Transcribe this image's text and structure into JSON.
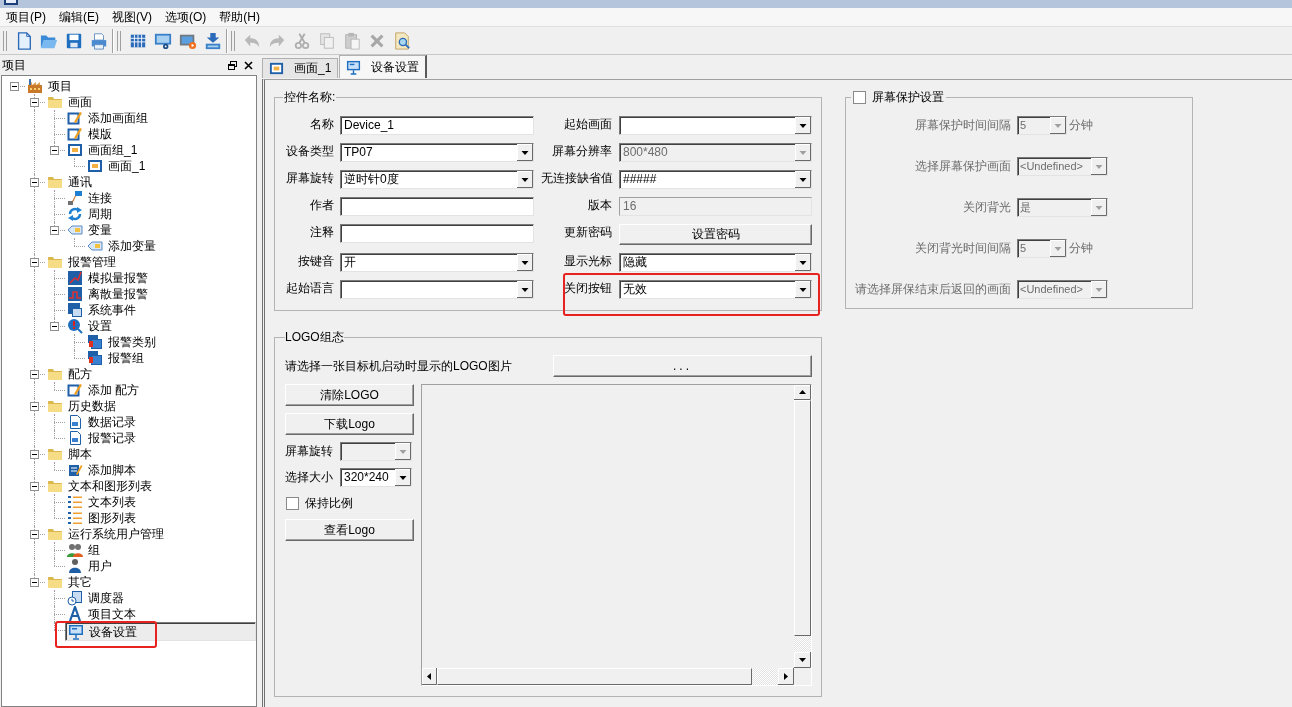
{
  "menu": [
    "项目(P)",
    "编辑(E)",
    "视图(V)",
    "选项(O)",
    "帮助(H)"
  ],
  "toolbar": [
    [
      {
        "kind": "new",
        "disabled": false
      },
      {
        "kind": "open",
        "disabled": false
      },
      {
        "kind": "save",
        "disabled": false
      },
      {
        "kind": "print",
        "disabled": false
      }
    ],
    [
      {
        "kind": "grid",
        "disabled": false
      },
      {
        "kind": "screen-gear",
        "disabled": false
      },
      {
        "kind": "screen-play",
        "disabled": false
      },
      {
        "kind": "download",
        "disabled": false
      }
    ],
    [
      {
        "kind": "undo",
        "disabled": true
      },
      {
        "kind": "redo",
        "disabled": true
      },
      {
        "kind": "cut",
        "disabled": true
      },
      {
        "kind": "copy",
        "disabled": true
      },
      {
        "kind": "paste",
        "disabled": true
      },
      {
        "kind": "delete",
        "disabled": true
      },
      {
        "kind": "preview",
        "disabled": false
      }
    ]
  ],
  "project_panel": {
    "title": "项目",
    "tree": [
      {
        "label": "项目",
        "kind": "factory",
        "expanded": true,
        "selected": false,
        "highlighted": false,
        "children": [
          {
            "label": "画面",
            "kind": "folder",
            "expanded": true,
            "selected": false,
            "highlighted": false,
            "children": [
              {
                "label": "添加画面组",
                "kind": "edit",
                "selected": false,
                "highlighted": false
              },
              {
                "label": "模版",
                "kind": "edit",
                "selected": false,
                "highlighted": false
              },
              {
                "label": "画面组_1",
                "kind": "screen",
                "expanded": true,
                "selected": false,
                "highlighted": false,
                "children": [
                  {
                    "label": "画面_1",
                    "kind": "screen",
                    "selected": false,
                    "highlighted": false
                  }
                ]
              }
            ]
          },
          {
            "label": "通讯",
            "kind": "folder",
            "expanded": true,
            "selected": false,
            "highlighted": false,
            "children": [
              {
                "label": "连接",
                "kind": "link",
                "selected": false,
                "highlighted": false
              },
              {
                "label": "周期",
                "kind": "cycle",
                "selected": false,
                "highlighted": false
              },
              {
                "label": "变量",
                "kind": "tag",
                "expanded": true,
                "selected": false,
                "highlighted": false,
                "children": [
                  {
                    "label": "添加变量",
                    "kind": "tag",
                    "selected": false,
                    "highlighted": false
                  }
                ]
              }
            ]
          },
          {
            "label": "报警管理",
            "kind": "folder",
            "expanded": true,
            "selected": false,
            "highlighted": false,
            "children": [
              {
                "label": "模拟量报警",
                "kind": "chart",
                "selected": false,
                "highlighted": false
              },
              {
                "label": "离散量报警",
                "kind": "pulse",
                "selected": false,
                "highlighted": false
              },
              {
                "label": "系统事件",
                "kind": "window",
                "selected": false,
                "highlighted": false
              },
              {
                "label": "设置",
                "kind": "alert",
                "expanded": true,
                "selected": false,
                "highlighted": false,
                "children": [
                  {
                    "label": "报警类别",
                    "kind": "stack",
                    "selected": false,
                    "highlighted": false
                  },
                  {
                    "label": "报警组",
                    "kind": "stack",
                    "selected": false,
                    "highlighted": false
                  }
                ]
              }
            ]
          },
          {
            "label": "配方",
            "kind": "folder",
            "expanded": true,
            "selected": false,
            "highlighted": false,
            "children": [
              {
                "label": "添加 配方",
                "kind": "edit",
                "selected": false,
                "highlighted": false
              }
            ]
          },
          {
            "label": "历史数据",
            "kind": "folder",
            "expanded": true,
            "selected": false,
            "highlighted": false,
            "children": [
              {
                "label": "数据记录",
                "kind": "doc",
                "selected": false,
                "highlighted": false
              },
              {
                "label": "报警记录",
                "kind": "doc",
                "selected": false,
                "highlighted": false
              }
            ]
          },
          {
            "label": "脚本",
            "kind": "folder",
            "expanded": true,
            "selected": false,
            "highlighted": false,
            "children": [
              {
                "label": "添加脚本",
                "kind": "script",
                "selected": false,
                "highlighted": false
              }
            ]
          },
          {
            "label": "文本和图形列表",
            "kind": "folder",
            "expanded": true,
            "selected": false,
            "highlighted": false,
            "children": [
              {
                "label": "文本列表",
                "kind": "list",
                "selected": false,
                "highlighted": false
              },
              {
                "label": "图形列表",
                "kind": "list",
                "selected": false,
                "highlighted": false
              }
            ]
          },
          {
            "label": "运行系统用户管理",
            "kind": "folder",
            "expanded": true,
            "selected": false,
            "highlighted": false,
            "children": [
              {
                "label": "组",
                "kind": "users",
                "selected": false,
                "highlighted": false
              },
              {
                "label": "用户",
                "kind": "user",
                "selected": false,
                "highlighted": false
              }
            ]
          },
          {
            "label": "其它",
            "kind": "folder",
            "expanded": true,
            "selected": false,
            "highlighted": false,
            "children": [
              {
                "label": "调度器",
                "kind": "clock",
                "selected": false,
                "highlighted": false
              },
              {
                "label": "项目文本",
                "kind": "text",
                "selected": false,
                "highlighted": false
              },
              {
                "label": "设备设置",
                "kind": "monitor",
                "selected": true,
                "highlighted": true
              }
            ]
          }
        ]
      }
    ]
  },
  "tabs": [
    {
      "label": "画面_1",
      "kind": "screen",
      "selected": false
    },
    {
      "label": "设备设置",
      "kind": "monitor",
      "selected": true
    }
  ],
  "device_group": {
    "title": "控件名称:",
    "columns": [
      [
        {
          "label": "名称",
          "kind": "text",
          "value": "Device_1",
          "disabled": false,
          "highlighted": false
        },
        {
          "label": "设备类型",
          "kind": "select",
          "value": "TP07",
          "disabled": false,
          "highlighted": false
        },
        {
          "label": "屏幕旋转",
          "kind": "select",
          "value": "逆时针0度",
          "disabled": false,
          "highlighted": false
        },
        {
          "label": "作者",
          "kind": "text",
          "disabled": false,
          "highlighted": false
        },
        {
          "label": "注释",
          "kind": "text",
          "disabled": false,
          "highlighted": false
        },
        {
          "label": "按键音",
          "kind": "select",
          "value": "开",
          "disabled": false,
          "highlighted": false
        },
        {
          "label": "起始语言",
          "kind": "select",
          "disabled": false,
          "highlighted": false
        }
      ],
      [
        {
          "label": "起始画面",
          "kind": "select",
          "disabled": false,
          "highlighted": false
        },
        {
          "label": "屏幕分辨率",
          "kind": "select",
          "value": "800*480",
          "disabled": true,
          "highlighted": false
        },
        {
          "label": "无连接缺省值",
          "kind": "select",
          "value": "#####",
          "disabled": false,
          "highlighted": false
        },
        {
          "label": "版本",
          "kind": "text",
          "value": "16",
          "disabled": true,
          "highlighted": false
        },
        {
          "label": "更新密码",
          "kind": "button",
          "button_label": "设置密码",
          "disabled": false,
          "highlighted": false
        },
        {
          "label": "显示光标",
          "kind": "select",
          "value": "隐藏",
          "disabled": false,
          "highlighted": false
        },
        {
          "label": "关闭按钮",
          "kind": "select",
          "value": "无效",
          "disabled": false,
          "highlighted": true
        }
      ]
    ]
  },
  "screen_saver": {
    "checked": false,
    "title": "屏幕保护设置",
    "fields": [
      {
        "label": "屏幕保护时间间隔",
        "value": "5",
        "unit": "分钟",
        "disabled": true
      },
      {
        "label": "选择屏幕保护画面",
        "value": "<Undefined>",
        "disabled": true
      },
      {
        "label": "关闭背光",
        "value": "是",
        "disabled": true
      },
      {
        "label": "关闭背光时间间隔",
        "value": "5",
        "unit": "分钟",
        "disabled": true
      },
      {
        "label": "请选择屏保结束后返回的画面",
        "value": "<Undefined>",
        "disabled": true
      }
    ]
  },
  "logo_group": {
    "title": "LOGO组态",
    "prompt": "请选择一张目标机启动时显示的LOGO图片",
    "browse_button": "...",
    "controls": [
      {
        "kind": "button",
        "label": "清除LOGO",
        "disabled": false
      },
      {
        "kind": "button",
        "label": "下载Logo",
        "disabled": false
      },
      {
        "kind": "select",
        "label": "屏幕旋转",
        "disabled": true
      },
      {
        "kind": "select",
        "label": "选择大小",
        "value": "320*240",
        "disabled": false
      },
      {
        "kind": "checkbox",
        "label": "保持比例",
        "checked": false,
        "disabled": false
      },
      {
        "kind": "button",
        "label": "查看Logo",
        "disabled": false
      }
    ]
  }
}
